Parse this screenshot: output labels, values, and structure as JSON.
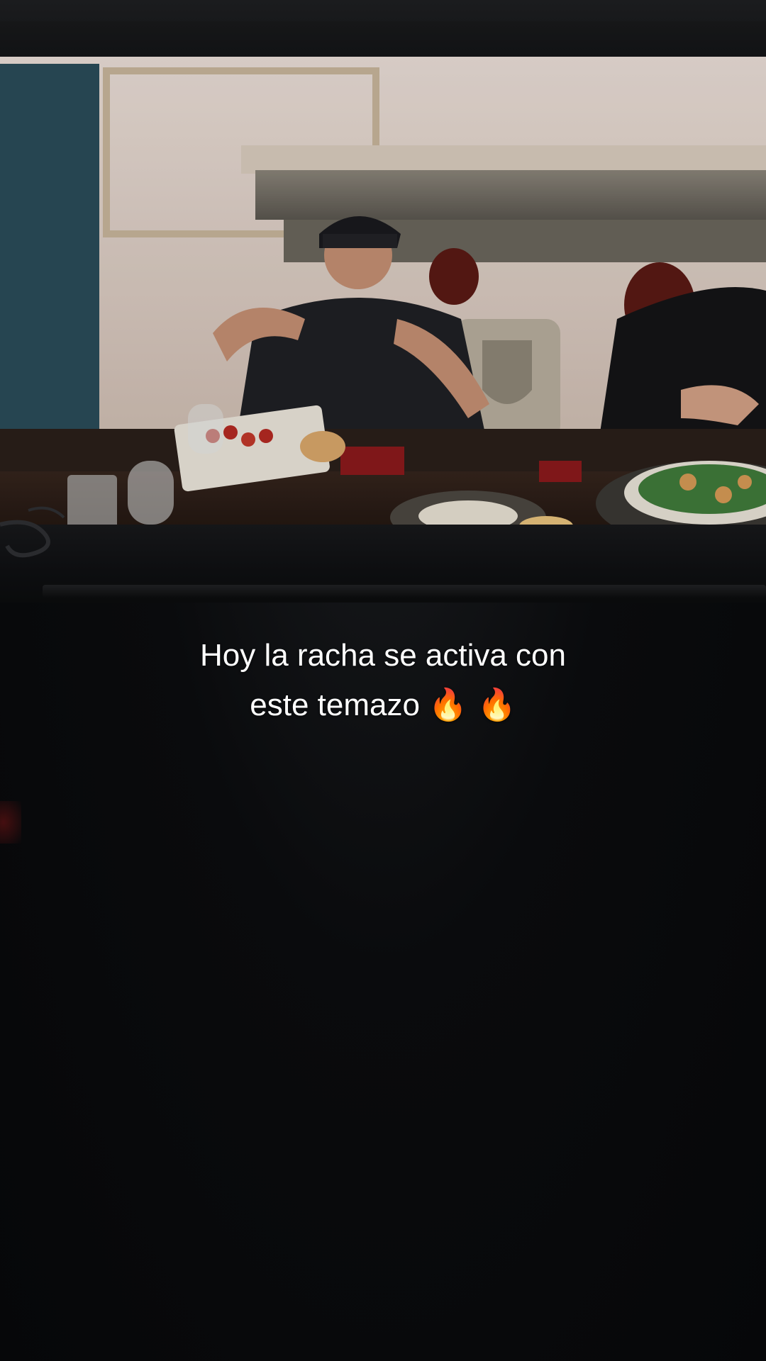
{
  "caption": {
    "line1": "Hoy la racha se activa con",
    "line2": "este temazo",
    "emoji": "🔥 🔥"
  },
  "colors": {
    "background": "#060709",
    "caption_text": "#ffffff",
    "accent_fire": "#ff7a1a"
  },
  "icons": {
    "fire": "fire-emoji"
  }
}
